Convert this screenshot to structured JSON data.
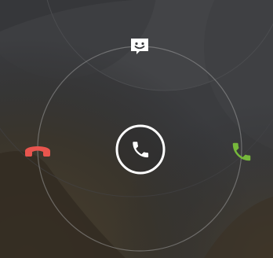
{
  "screen": {
    "name": "incoming-call-glowpad",
    "background_color": "#2a2b2d",
    "ring_color": "#9a9a9a",
    "decline_color": "#e8554e",
    "answer_color": "#76b83b",
    "message_color": "#ffffff",
    "handle_color": "#ffffff"
  },
  "targets": [
    {
      "id": "answer",
      "icon": "phone-answer-icon"
    },
    {
      "id": "decline",
      "icon": "phone-hangup-icon"
    },
    {
      "id": "message",
      "icon": "smiley-message-icon"
    },
    {
      "id": "handle",
      "icon": "phone-icon"
    }
  ]
}
